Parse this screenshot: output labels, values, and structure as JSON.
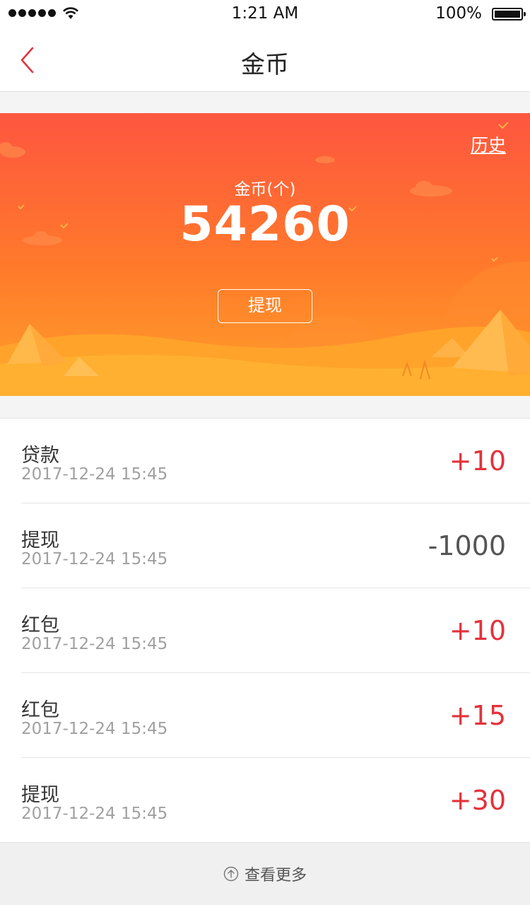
{
  "status_bar": {
    "time": "1:21 AM",
    "battery": "100%"
  },
  "nav": {
    "title": "金币",
    "back_icon": "chevron-left-icon"
  },
  "banner": {
    "history": "历史",
    "coin_label": "金币(个)",
    "coin_amount": "54260",
    "withdraw": "提现"
  },
  "records": [
    {
      "title": "贷款",
      "time": "2017-12-24  15:45",
      "amount": "+10"
    },
    {
      "title": "提现",
      "time": "2017-12-24  15:45",
      "amount": "-1000"
    },
    {
      "title": "红包",
      "time": "2017-12-24  15:45",
      "amount": "+10"
    },
    {
      "title": "红包",
      "time": "2017-12-24  15:45",
      "amount": "+15"
    },
    {
      "title": "提现",
      "time": "2017-12-24  15:45",
      "amount": "+30"
    }
  ],
  "footer": {
    "more": "查看更多"
  },
  "colors": {
    "accent": "#e4313a",
    "banner_top": "#fe5640",
    "banner_bottom": "#ffa12a"
  }
}
